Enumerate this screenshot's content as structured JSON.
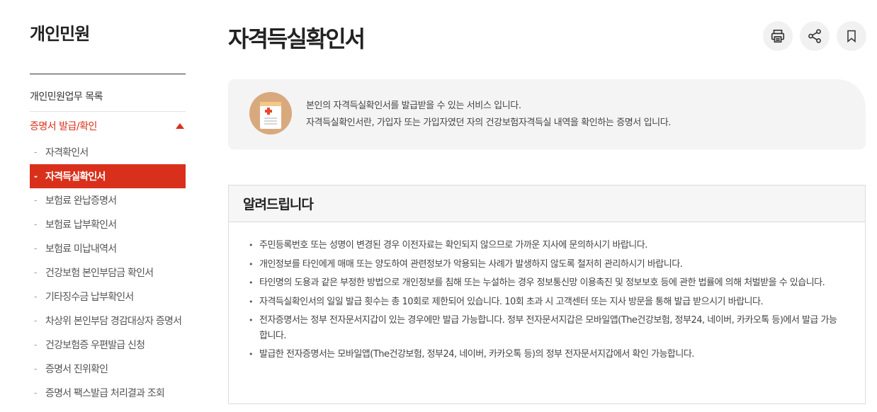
{
  "sidebar": {
    "title": "개인민원",
    "list_link": "개인민원업무 목록",
    "group_label": "증명서 발급/확인",
    "items": [
      {
        "label": "자격확인서",
        "active": false
      },
      {
        "label": "자격득실확인서",
        "active": true
      },
      {
        "label": "보험료 완납증명서",
        "active": false
      },
      {
        "label": "보험료 납부확인서",
        "active": false
      },
      {
        "label": "보험료 미납내역서",
        "active": false
      },
      {
        "label": "건강보험 본인부담금 확인서",
        "active": false
      },
      {
        "label": "기타징수금 납부확인서",
        "active": false
      },
      {
        "label": "차상위 본인부담 경감대상자 증명서",
        "active": false
      },
      {
        "label": "건강보험증 우편발급 신청",
        "active": false
      },
      {
        "label": "증명서 진위확인",
        "active": false
      },
      {
        "label": "증명서 팩스발급 처리결과 조회",
        "active": false
      }
    ]
  },
  "page": {
    "title": "자격득실확인서",
    "tools": {
      "print": "print-icon",
      "share": "share-icon",
      "bookmark": "bookmark-icon"
    }
  },
  "intro": {
    "line1": "본인의 자격득실확인서를 발급받을 수 있는 서비스 입니다.",
    "line2": "자격득실확인서란, 가입자 또는 가입자였던 자의 건강보험자격득실 내역을 확인하는 증명서 입니다."
  },
  "notice": {
    "title": "알려드립니다",
    "items": [
      "주민등록번호 또는 성명이 변경된 경우 이전자료는 확인되지 않으므로 가까운 지사에 문의하시기 바랍니다.",
      "개인정보를 타인에게 매매 또는 양도하여 관련정보가 악용되는 사례가 발생하지 않도록 철저히 관리하시기 바랍니다.",
      "타인명의 도용과 같은 부정한 방법으로 개인정보를 침해 또는 누설하는 경우 정보통신망 이용촉진 및 정보보호 등에 관한 법률에 의해 처벌받을 수 있습니다.",
      "자격득실확인서의 일일 발급 횟수는 총 10회로 제한되어 있습니다. 10회 초과 시 고객센터 또는 지사 방문을 통해 발급 받으시기 바랍니다.",
      "전자증명서는 정부 전자문서지갑이 있는 경우에만 발급 가능합니다. 정부 전자문서지갑은 모바일앱(The건강보험, 정부24, 네이버, 카카오톡 등)에서 발급 가능합니다.",
      "발급한 전자증명서는 모바일앱(The건강보험, 정부24, 네이버, 카카오톡 등)의 정부 전자문서지갑에서 확인 가능합니다."
    ]
  },
  "colors": {
    "accent": "#d9301c",
    "box_bg": "#f4f4f4",
    "icon_bg": "#d9a97e"
  }
}
